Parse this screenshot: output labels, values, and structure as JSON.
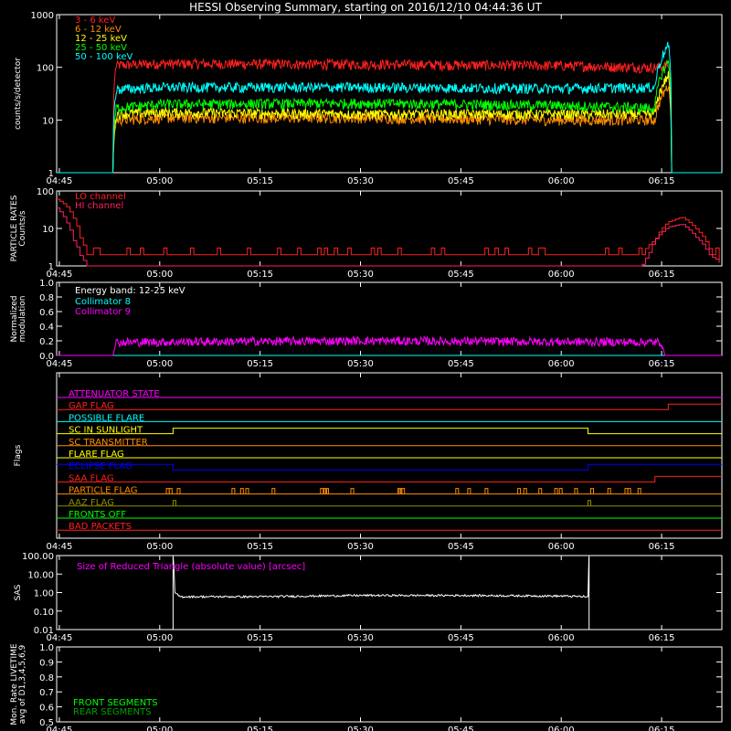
{
  "title": "HESSI Observing Summary, starting on 2016/12/10 04:44:36 UT",
  "colors": {
    "background": "#000000",
    "axes": "#ffffff",
    "red": "#ff2020",
    "orange": "#ff8c00",
    "yellow": "#ffff00",
    "green": "#00ff00",
    "cyan": "#00ffff",
    "magenta": "#ff00ff",
    "blue": "#0000ff",
    "olive": "#8c8c00",
    "darkgreen": "#00a000",
    "crimson": "#d01040"
  },
  "time_ticks": [
    "04:45",
    "05:00",
    "05:15",
    "05:30",
    "05:45",
    "06:00",
    "06:15"
  ],
  "chart_data": [
    {
      "id": "counts",
      "type": "line",
      "ylabel": "counts/s/detector",
      "yscale": "log",
      "ylim": [
        1,
        1000
      ],
      "yticks": [
        "1",
        "10",
        "100",
        "1000"
      ],
      "xlim": [
        "04:44:36",
        "06:24:00"
      ],
      "legend_placement": "top-left",
      "series": [
        {
          "name": "3 - 6 keV",
          "color": "#ff2020",
          "x": [
            "04:44:36",
            "04:53:00",
            "04:53:30",
            "05:00",
            "05:30",
            "06:00",
            "06:14",
            "06:16",
            "06:16:30",
            "06:24"
          ],
          "y": [
            1,
            1,
            110,
            118,
            115,
            108,
            100,
            110,
            1,
            1
          ]
        },
        {
          "name": "6 - 12 keV",
          "color": "#ff8c00",
          "x": [
            "04:44:36",
            "04:53:00",
            "04:53:30",
            "05:00",
            "05:30",
            "06:00",
            "06:14",
            "06:16",
            "06:16:30",
            "06:24"
          ],
          "y": [
            1,
            1,
            10,
            11,
            11,
            10,
            10,
            45,
            1,
            1
          ]
        },
        {
          "name": "12 - 25 keV",
          "color": "#ffff00",
          "x": [
            "04:44:36",
            "04:53:00",
            "04:53:30",
            "05:00",
            "05:30",
            "06:00",
            "06:14",
            "06:16",
            "06:16:30",
            "06:24"
          ],
          "y": [
            1,
            1,
            13,
            14,
            13,
            13,
            13,
            70,
            1,
            1
          ]
        },
        {
          "name": "25 - 50 keV",
          "color": "#00ff00",
          "x": [
            "04:44:36",
            "04:53:00",
            "04:53:30",
            "05:00",
            "05:30",
            "06:00",
            "06:14",
            "06:16",
            "06:16:30",
            "06:24"
          ],
          "y": [
            1,
            1,
            17,
            20,
            21,
            19,
            17,
            130,
            1,
            1
          ]
        },
        {
          "name": "50 - 100 keV",
          "color": "#00ffff",
          "x": [
            "04:44:36",
            "04:53:00",
            "04:53:30",
            "05:00",
            "05:30",
            "06:00",
            "06:14",
            "06:16",
            "06:16:30",
            "06:24"
          ],
          "y": [
            1,
            1,
            38,
            42,
            42,
            40,
            42,
            260,
            1,
            1
          ]
        }
      ]
    },
    {
      "id": "particle",
      "type": "line",
      "ylabel": "PARTICLE RATES Counts/s",
      "yscale": "log",
      "ylim": [
        1,
        100
      ],
      "yticks": [
        "1",
        "10",
        "100"
      ],
      "xlim": [
        "04:44:36",
        "06:24:00"
      ],
      "legend_placement": "top-left",
      "series": [
        {
          "name": "LO channel",
          "color": "#ff2020",
          "x": [
            "04:44:36",
            "04:46",
            "04:47",
            "04:48",
            "04:49",
            "04:50",
            "04:52",
            "05:00",
            "05:30",
            "06:00",
            "06:12",
            "06:14",
            "06:16",
            "06:18",
            "06:20",
            "06:22",
            "06:24"
          ],
          "y": [
            60,
            40,
            20,
            6,
            2,
            2,
            2,
            2,
            2,
            2,
            2,
            5,
            15,
            20,
            10,
            3,
            1
          ]
        },
        {
          "name": "HI channel",
          "color": "#ff2060",
          "x": [
            "04:44:36",
            "04:46",
            "04:47",
            "04:48",
            "04:49",
            "04:50",
            "06:12",
            "06:13",
            "06:14",
            "06:16",
            "06:18",
            "06:20",
            "06:22",
            "06:24"
          ],
          "y": [
            35,
            15,
            5,
            2,
            1,
            1,
            1,
            2,
            5,
            11,
            13,
            6,
            2,
            1
          ]
        }
      ]
    },
    {
      "id": "modulation",
      "type": "line",
      "ylabel": "Normalized modulation",
      "ylim": [
        0.0,
        1.0
      ],
      "yticks": [
        "0.0",
        "0.2",
        "0.4",
        "0.6",
        "0.8",
        "1.0"
      ],
      "xlim": [
        "04:44:36",
        "06:24:00"
      ],
      "annotation": "Energy band: 12-25 keV",
      "legend_placement": "top-left",
      "series": [
        {
          "name": "Collimator 8",
          "color": "#00ffff",
          "x": [
            "04:44:36",
            "06:24"
          ],
          "y": [
            0.0,
            0.0
          ]
        },
        {
          "name": "Collimator 9",
          "color": "#ff00ff",
          "x": [
            "04:44:36",
            "04:53:00",
            "04:53:30",
            "05:30",
            "06:15",
            "06:15:30",
            "06:24"
          ],
          "y": [
            0.0,
            0.0,
            0.18,
            0.2,
            0.18,
            0.0,
            0.0
          ]
        }
      ]
    },
    {
      "id": "flags",
      "type": "line",
      "ylabel": "Flags",
      "xlim": [
        "04:44:36",
        "06:24:00"
      ],
      "series": [
        {
          "name": "ATTENUATOR STATE",
          "color": "#ff00ff",
          "segments": [
            [
              "04:44:36",
              "06:24",
              0
            ]
          ]
        },
        {
          "name": "GAP FLAG",
          "color": "#ff2020",
          "segments": [
            [
              "04:44:36",
              "06:16",
              0
            ],
            [
              "06:16",
              "06:24",
              1
            ]
          ]
        },
        {
          "name": "POSSIBLE FLARE",
          "color": "#00ffff",
          "segments": [
            [
              "04:44:36",
              "06:24",
              0
            ]
          ]
        },
        {
          "name": "SC IN SUNLIGHT",
          "color": "#ffff00",
          "segments": [
            [
              "04:44:36",
              "05:02",
              0
            ],
            [
              "05:02",
              "06:04",
              1
            ],
            [
              "06:04",
              "06:24",
              0
            ]
          ]
        },
        {
          "name": "SC TRANSMITTER",
          "color": "#ff8c00",
          "segments": [
            [
              "04:44:36",
              "06:24",
              0
            ]
          ]
        },
        {
          "name": "FLARE FLAG",
          "color": "#ffff00",
          "segments": [
            [
              "04:44:36",
              "06:24",
              0
            ]
          ]
        },
        {
          "name": "ECLIPSE FLAG",
          "color": "#0000ff",
          "segments": [
            [
              "04:44:36",
              "05:02",
              1
            ],
            [
              "05:02",
              "06:04",
              0
            ],
            [
              "06:04",
              "06:24",
              1
            ]
          ]
        },
        {
          "name": "SAA FLAG",
          "color": "#ff2020",
          "segments": [
            [
              "04:44:36",
              "06:14",
              0
            ],
            [
              "06:14",
              "06:24",
              1
            ]
          ]
        },
        {
          "name": "PARTICLE FLAG",
          "color": "#ff8c00",
          "segments": [
            [
              "04:44:36",
              "06:24",
              0
            ]
          ]
        },
        {
          "name": "AAZ FLAG",
          "color": "#8c8c00",
          "segments": [
            [
              "04:44:36",
              "06:24",
              0
            ]
          ]
        },
        {
          "name": "FRONTS OFF",
          "color": "#00ff00",
          "segments": [
            [
              "04:44:36",
              "06:24",
              0
            ]
          ]
        },
        {
          "name": "BAD PACKETS",
          "color": "#ff2020",
          "segments": [
            [
              "04:44:36",
              "06:24",
              0
            ]
          ]
        }
      ]
    },
    {
      "id": "sas",
      "type": "line",
      "ylabel": "SAS",
      "yscale": "log",
      "ylim": [
        0.01,
        100.0
      ],
      "yticks": [
        "0.01",
        "0.10",
        "1.00",
        "10.00",
        "100.00"
      ],
      "xlim": [
        "04:44:36",
        "06:24:00"
      ],
      "annotation": "Size of Reduced Triangle (absolute value) [arcsec]",
      "series": [
        {
          "name": "Size of Reduced Triangle",
          "color": "#ffffff",
          "x": [
            "05:02:00",
            "05:02:10",
            "05:03",
            "05:15",
            "05:30",
            "05:45",
            "06:00",
            "06:04:00",
            "06:04:10"
          ],
          "y": [
            100.0,
            1.0,
            0.6,
            0.6,
            0.7,
            0.7,
            0.65,
            0.6,
            100.0
          ]
        }
      ]
    },
    {
      "id": "monitor",
      "type": "line",
      "ylabel": "Mon. Rate LIVETIME avg of D1,3,4,5,6,9",
      "ylim": [
        0.5,
        1.0
      ],
      "yticks": [
        "0.5",
        "0.6",
        "0.7",
        "0.8",
        "0.9",
        "1.0"
      ],
      "xlim": [
        "04:44:36",
        "06:24:00"
      ],
      "series": [
        {
          "name": "FRONT SEGMENTS",
          "color": "#00ff00",
          "x": [],
          "y": []
        },
        {
          "name": "REAR SEGMENTS",
          "color": "#00a000",
          "x": [],
          "y": []
        }
      ]
    }
  ]
}
